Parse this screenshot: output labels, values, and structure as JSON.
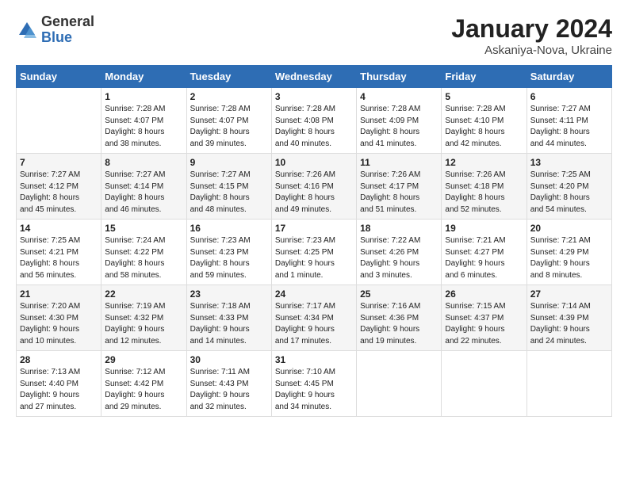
{
  "header": {
    "logo_general": "General",
    "logo_blue": "Blue",
    "title": "January 2024",
    "subtitle": "Askaniya-Nova, Ukraine"
  },
  "columns": [
    "Sunday",
    "Monday",
    "Tuesday",
    "Wednesday",
    "Thursday",
    "Friday",
    "Saturday"
  ],
  "weeks": [
    {
      "shade": "white",
      "days": [
        {
          "num": "",
          "info": ""
        },
        {
          "num": "1",
          "info": "Sunrise: 7:28 AM\nSunset: 4:07 PM\nDaylight: 8 hours\nand 38 minutes."
        },
        {
          "num": "2",
          "info": "Sunrise: 7:28 AM\nSunset: 4:07 PM\nDaylight: 8 hours\nand 39 minutes."
        },
        {
          "num": "3",
          "info": "Sunrise: 7:28 AM\nSunset: 4:08 PM\nDaylight: 8 hours\nand 40 minutes."
        },
        {
          "num": "4",
          "info": "Sunrise: 7:28 AM\nSunset: 4:09 PM\nDaylight: 8 hours\nand 41 minutes."
        },
        {
          "num": "5",
          "info": "Sunrise: 7:28 AM\nSunset: 4:10 PM\nDaylight: 8 hours\nand 42 minutes."
        },
        {
          "num": "6",
          "info": "Sunrise: 7:27 AM\nSunset: 4:11 PM\nDaylight: 8 hours\nand 44 minutes."
        }
      ]
    },
    {
      "shade": "shaded",
      "days": [
        {
          "num": "7",
          "info": "Sunrise: 7:27 AM\nSunset: 4:12 PM\nDaylight: 8 hours\nand 45 minutes."
        },
        {
          "num": "8",
          "info": "Sunrise: 7:27 AM\nSunset: 4:14 PM\nDaylight: 8 hours\nand 46 minutes."
        },
        {
          "num": "9",
          "info": "Sunrise: 7:27 AM\nSunset: 4:15 PM\nDaylight: 8 hours\nand 48 minutes."
        },
        {
          "num": "10",
          "info": "Sunrise: 7:26 AM\nSunset: 4:16 PM\nDaylight: 8 hours\nand 49 minutes."
        },
        {
          "num": "11",
          "info": "Sunrise: 7:26 AM\nSunset: 4:17 PM\nDaylight: 8 hours\nand 51 minutes."
        },
        {
          "num": "12",
          "info": "Sunrise: 7:26 AM\nSunset: 4:18 PM\nDaylight: 8 hours\nand 52 minutes."
        },
        {
          "num": "13",
          "info": "Sunrise: 7:25 AM\nSunset: 4:20 PM\nDaylight: 8 hours\nand 54 minutes."
        }
      ]
    },
    {
      "shade": "white",
      "days": [
        {
          "num": "14",
          "info": "Sunrise: 7:25 AM\nSunset: 4:21 PM\nDaylight: 8 hours\nand 56 minutes."
        },
        {
          "num": "15",
          "info": "Sunrise: 7:24 AM\nSunset: 4:22 PM\nDaylight: 8 hours\nand 58 minutes."
        },
        {
          "num": "16",
          "info": "Sunrise: 7:23 AM\nSunset: 4:23 PM\nDaylight: 8 hours\nand 59 minutes."
        },
        {
          "num": "17",
          "info": "Sunrise: 7:23 AM\nSunset: 4:25 PM\nDaylight: 9 hours\nand 1 minute."
        },
        {
          "num": "18",
          "info": "Sunrise: 7:22 AM\nSunset: 4:26 PM\nDaylight: 9 hours\nand 3 minutes."
        },
        {
          "num": "19",
          "info": "Sunrise: 7:21 AM\nSunset: 4:27 PM\nDaylight: 9 hours\nand 6 minutes."
        },
        {
          "num": "20",
          "info": "Sunrise: 7:21 AM\nSunset: 4:29 PM\nDaylight: 9 hours\nand 8 minutes."
        }
      ]
    },
    {
      "shade": "shaded",
      "days": [
        {
          "num": "21",
          "info": "Sunrise: 7:20 AM\nSunset: 4:30 PM\nDaylight: 9 hours\nand 10 minutes."
        },
        {
          "num": "22",
          "info": "Sunrise: 7:19 AM\nSunset: 4:32 PM\nDaylight: 9 hours\nand 12 minutes."
        },
        {
          "num": "23",
          "info": "Sunrise: 7:18 AM\nSunset: 4:33 PM\nDaylight: 9 hours\nand 14 minutes."
        },
        {
          "num": "24",
          "info": "Sunrise: 7:17 AM\nSunset: 4:34 PM\nDaylight: 9 hours\nand 17 minutes."
        },
        {
          "num": "25",
          "info": "Sunrise: 7:16 AM\nSunset: 4:36 PM\nDaylight: 9 hours\nand 19 minutes."
        },
        {
          "num": "26",
          "info": "Sunrise: 7:15 AM\nSunset: 4:37 PM\nDaylight: 9 hours\nand 22 minutes."
        },
        {
          "num": "27",
          "info": "Sunrise: 7:14 AM\nSunset: 4:39 PM\nDaylight: 9 hours\nand 24 minutes."
        }
      ]
    },
    {
      "shade": "white",
      "days": [
        {
          "num": "28",
          "info": "Sunrise: 7:13 AM\nSunset: 4:40 PM\nDaylight: 9 hours\nand 27 minutes."
        },
        {
          "num": "29",
          "info": "Sunrise: 7:12 AM\nSunset: 4:42 PM\nDaylight: 9 hours\nand 29 minutes."
        },
        {
          "num": "30",
          "info": "Sunrise: 7:11 AM\nSunset: 4:43 PM\nDaylight: 9 hours\nand 32 minutes."
        },
        {
          "num": "31",
          "info": "Sunrise: 7:10 AM\nSunset: 4:45 PM\nDaylight: 9 hours\nand 34 minutes."
        },
        {
          "num": "",
          "info": ""
        },
        {
          "num": "",
          "info": ""
        },
        {
          "num": "",
          "info": ""
        }
      ]
    }
  ]
}
